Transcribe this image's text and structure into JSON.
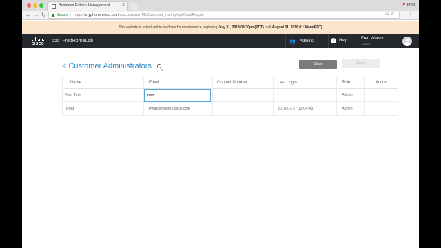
{
  "browser": {
    "tab_title": "Business Edition Management",
    "profile_name": "Fred",
    "secure_label": "Secure",
    "url_scheme": "https://",
    "url_host": "myphone.cisco.com",
    "url_path": "/mecustomer/MeCustomer_main.php#/CustPeople"
  },
  "banner": {
    "prefix": "This website is scheduled to be down for maintenance beginning ",
    "start": "July 31, 2018 08:30pm(PDT)",
    "middle": " until ",
    "end": "August 01, 2018 01:30am(PDT)"
  },
  "header": {
    "logo_text": "CISCO",
    "customer_name": "zzz_FredHomeLab",
    "admins_label": "Admins",
    "help_label": "Help",
    "user_name": "Fred Watson",
    "user_role": "Admin"
  },
  "page": {
    "title": "< Customer Administrators",
    "close_label": "Close",
    "save_label": "Save"
  },
  "table": {
    "columns": [
      "Name",
      "Email",
      "Contact Number",
      "Last Login",
      "Role",
      "Action"
    ],
    "edit_row": {
      "name": "Fred Test",
      "email": "fred",
      "contact": "",
      "last_login": "",
      "role": "Admin",
      "action": ""
    },
    "rows": [
      {
        "name": "Fred",
        "email": "frwatson@go2cisco.com",
        "contact": "",
        "last_login": "2018-07-27 13:04:48",
        "role": "Admin",
        "action": ""
      }
    ]
  },
  "colors": {
    "link_blue": "#2b8ec6",
    "header_bg": "#25282c",
    "banner_bg": "#fbe6cc",
    "focus_border": "#5aa7d6"
  }
}
